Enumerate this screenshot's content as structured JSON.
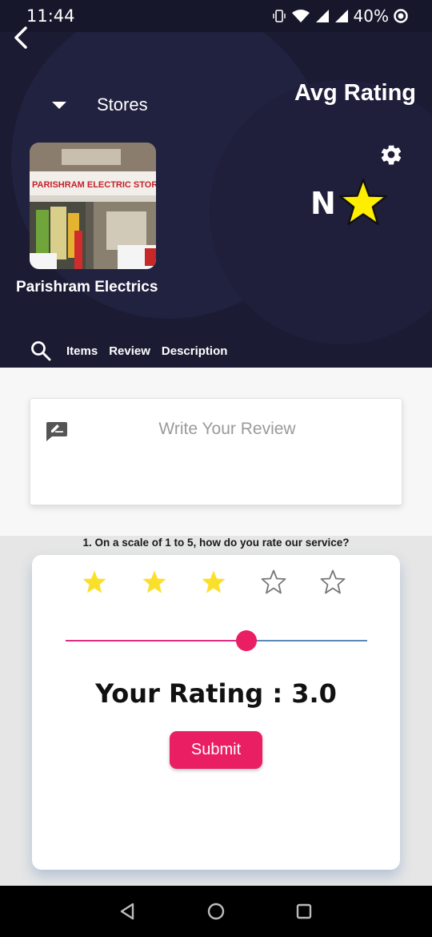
{
  "status_bar": {
    "time": "11:44",
    "battery": "40%"
  },
  "header": {
    "avg_rating_title": "Avg Rating",
    "stores_label": "Stores",
    "rating_value": "N",
    "store_name": "Parishram Electrics",
    "store_photo_sign": "PARISHRAM ELECTRIC STORE",
    "tabs": [
      {
        "label": "Items"
      },
      {
        "label": "Review"
      },
      {
        "label": "Description"
      }
    ]
  },
  "review": {
    "placeholder": "Write Your Review"
  },
  "question": "1. On a scale of 1 to 5, how do you rate our service?",
  "rating": {
    "stars_total": 5,
    "stars_filled": 3,
    "slider_value": 3.0,
    "slider_max": 5,
    "your_rating_text": "Your Rating : 3.0",
    "submit_label": "Submit"
  },
  "colors": {
    "header_bg": "#1b1b33",
    "accent": "#e91e63",
    "star_filled": "#fbe02b",
    "star_big": "#ffee00"
  },
  "icons": [
    "back-arrow-icon",
    "dropdown-caret-icon",
    "gear-icon",
    "star-icon",
    "search-icon",
    "rate-review-icon",
    "nav-back-icon",
    "nav-home-icon",
    "nav-recents-icon"
  ]
}
